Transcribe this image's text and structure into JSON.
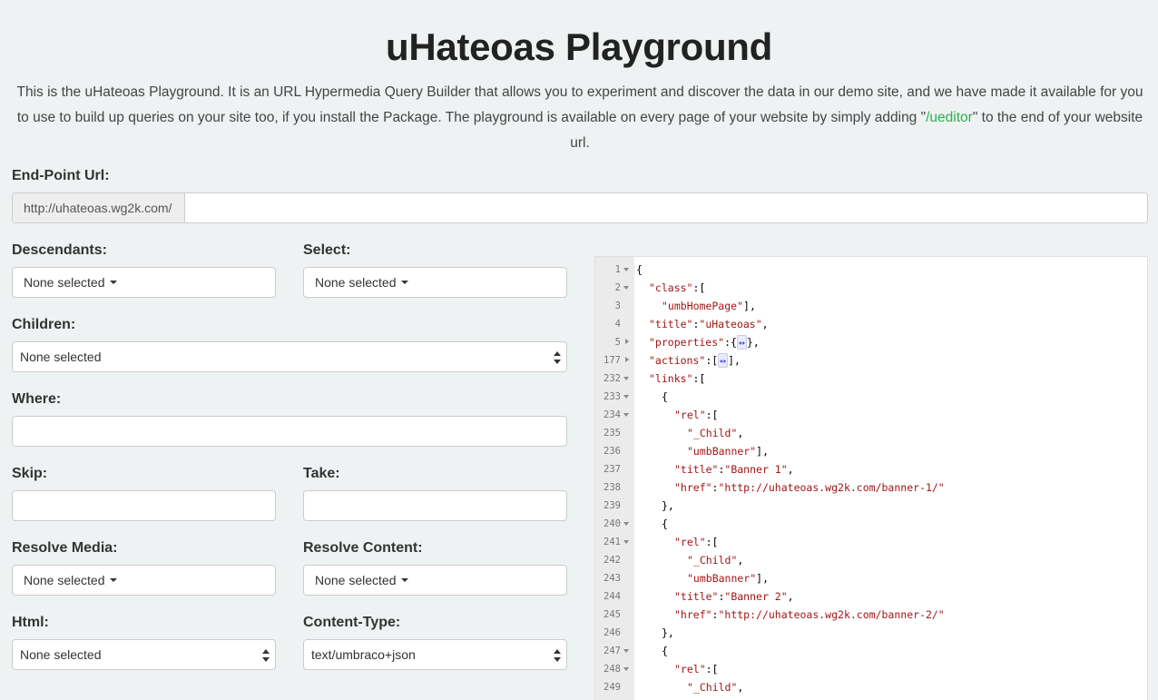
{
  "page": {
    "title": "uHateoas Playground",
    "intro_before": "This is the uHateoas Playground. It is an URL Hypermedia Query Builder that allows you to experiment and discover the data in our demo site, and we have made it available for you to use to build up queries on your site too, if you install the Package. The playground is available on every page of your website by simply adding \"",
    "intro_link": "/ueditor",
    "intro_after": "\" to the end of your website url."
  },
  "form": {
    "endpoint_label": "End-Point Url:",
    "endpoint_prefix": "http://uhateoas.wg2k.com/",
    "endpoint_value": "",
    "descendants_label": "Descendants:",
    "descendants_value": "None selected",
    "select_label": "Select:",
    "select_value": "None selected",
    "children_label": "Children:",
    "children_value": "None selected",
    "where_label": "Where:",
    "where_value": "",
    "skip_label": "Skip:",
    "skip_value": "",
    "take_label": "Take:",
    "take_value": "",
    "resolve_media_label": "Resolve Media:",
    "resolve_media_value": "None selected",
    "resolve_content_label": "Resolve Content:",
    "resolve_content_value": "None selected",
    "html_label": "Html:",
    "html_value": "None selected",
    "content_type_label": "Content-Type:",
    "content_type_value": "text/umbraco+json"
  },
  "editor": {
    "lines": [
      {
        "n": "1",
        "fold": "open",
        "indent": 0,
        "parts": [
          [
            "p",
            "{"
          ]
        ]
      },
      {
        "n": "2",
        "fold": "open",
        "indent": 1,
        "parts": [
          [
            "k",
            "\"class\""
          ],
          [
            "p",
            ":["
          ]
        ]
      },
      {
        "n": "3",
        "fold": "",
        "indent": 2,
        "parts": [
          [
            "s",
            "\"umbHomePage\""
          ],
          [
            "p",
            "],"
          ]
        ]
      },
      {
        "n": "4",
        "fold": "",
        "indent": 1,
        "parts": [
          [
            "k",
            "\"title\""
          ],
          [
            "p",
            ":"
          ],
          [
            "s",
            "\"uHateoas\""
          ],
          [
            "p",
            ","
          ]
        ]
      },
      {
        "n": "5",
        "fold": "closed",
        "indent": 1,
        "parts": [
          [
            "k",
            "\"properties\""
          ],
          [
            "p",
            ":{"
          ],
          [
            "ph",
            "↔"
          ],
          [
            "p",
            "},"
          ]
        ]
      },
      {
        "n": "177",
        "fold": "closed",
        "indent": 1,
        "parts": [
          [
            "k",
            "\"actions\""
          ],
          [
            "p",
            ":["
          ],
          [
            "ph",
            "↔"
          ],
          [
            "p",
            "],"
          ]
        ]
      },
      {
        "n": "232",
        "fold": "open",
        "indent": 1,
        "parts": [
          [
            "k",
            "\"links\""
          ],
          [
            "p",
            ":["
          ]
        ]
      },
      {
        "n": "233",
        "fold": "open",
        "indent": 2,
        "parts": [
          [
            "p",
            "{"
          ]
        ]
      },
      {
        "n": "234",
        "fold": "open",
        "indent": 3,
        "parts": [
          [
            "k",
            "\"rel\""
          ],
          [
            "p",
            ":["
          ]
        ]
      },
      {
        "n": "235",
        "fold": "",
        "indent": 4,
        "parts": [
          [
            "s",
            "\"_Child\""
          ],
          [
            "p",
            ","
          ]
        ]
      },
      {
        "n": "236",
        "fold": "",
        "indent": 4,
        "parts": [
          [
            "s",
            "\"umbBanner\""
          ],
          [
            "p",
            "],"
          ]
        ]
      },
      {
        "n": "237",
        "fold": "",
        "indent": 3,
        "parts": [
          [
            "k",
            "\"title\""
          ],
          [
            "p",
            ":"
          ],
          [
            "s",
            "\"Banner 1\""
          ],
          [
            "p",
            ","
          ]
        ]
      },
      {
        "n": "238",
        "fold": "",
        "indent": 3,
        "parts": [
          [
            "k",
            "\"href\""
          ],
          [
            "p",
            ":"
          ],
          [
            "s",
            "\"http://uhateoas.wg2k.com/banner-1/\""
          ]
        ]
      },
      {
        "n": "239",
        "fold": "",
        "indent": 2,
        "parts": [
          [
            "p",
            "},"
          ]
        ]
      },
      {
        "n": "240",
        "fold": "open",
        "indent": 2,
        "parts": [
          [
            "p",
            "{"
          ]
        ]
      },
      {
        "n": "241",
        "fold": "open",
        "indent": 3,
        "parts": [
          [
            "k",
            "\"rel\""
          ],
          [
            "p",
            ":["
          ]
        ]
      },
      {
        "n": "242",
        "fold": "",
        "indent": 4,
        "parts": [
          [
            "s",
            "\"_Child\""
          ],
          [
            "p",
            ","
          ]
        ]
      },
      {
        "n": "243",
        "fold": "",
        "indent": 4,
        "parts": [
          [
            "s",
            "\"umbBanner\""
          ],
          [
            "p",
            "],"
          ]
        ]
      },
      {
        "n": "244",
        "fold": "",
        "indent": 3,
        "parts": [
          [
            "k",
            "\"title\""
          ],
          [
            "p",
            ":"
          ],
          [
            "s",
            "\"Banner 2\""
          ],
          [
            "p",
            ","
          ]
        ]
      },
      {
        "n": "245",
        "fold": "",
        "indent": 3,
        "parts": [
          [
            "k",
            "\"href\""
          ],
          [
            "p",
            ":"
          ],
          [
            "s",
            "\"http://uhateoas.wg2k.com/banner-2/\""
          ]
        ]
      },
      {
        "n": "246",
        "fold": "",
        "indent": 2,
        "parts": [
          [
            "p",
            "},"
          ]
        ]
      },
      {
        "n": "247",
        "fold": "open",
        "indent": 2,
        "parts": [
          [
            "p",
            "{"
          ]
        ]
      },
      {
        "n": "248",
        "fold": "open",
        "indent": 3,
        "parts": [
          [
            "k",
            "\"rel\""
          ],
          [
            "p",
            ":["
          ]
        ]
      },
      {
        "n": "249",
        "fold": "",
        "indent": 4,
        "parts": [
          [
            "s",
            "\"_Child\""
          ],
          [
            "p",
            ","
          ]
        ]
      }
    ]
  }
}
